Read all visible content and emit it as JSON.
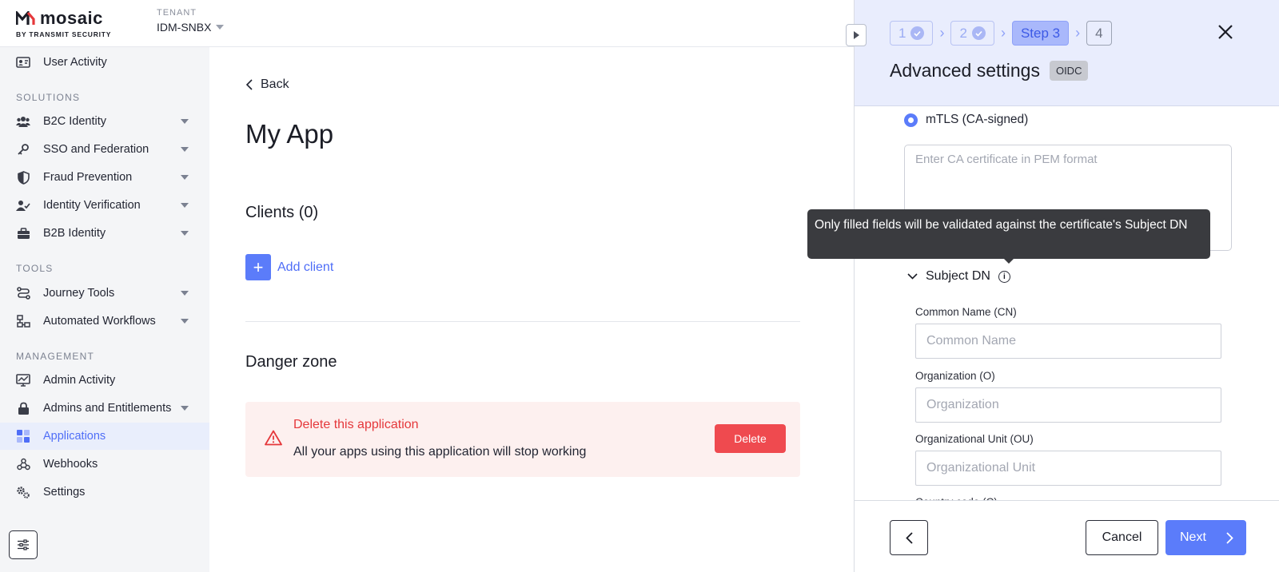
{
  "header": {
    "logo_text": "mosaic",
    "logo_sub": "BY TRANSMIT SECURITY",
    "tenant_label": "TENANT",
    "tenant_value": "IDM-SNBX"
  },
  "sidebar": {
    "top_item": "User Activity",
    "sections": {
      "solutions": "SOLUTIONS",
      "tools": "TOOLS",
      "management": "MANAGEMENT"
    },
    "items": [
      {
        "label": "B2C Identity",
        "icon": "users-icon"
      },
      {
        "label": "SSO and Federation",
        "icon": "key-icon"
      },
      {
        "label": "Fraud Prevention",
        "icon": "shield-icon"
      },
      {
        "label": "Identity Verification",
        "icon": "user-check-icon"
      },
      {
        "label": "B2B Identity",
        "icon": "briefcase-icon"
      },
      {
        "label": "Journey Tools",
        "icon": "route-icon"
      },
      {
        "label": "Automated Workflows",
        "icon": "workflow-icon"
      },
      {
        "label": "Admin Activity",
        "icon": "monitor-icon"
      },
      {
        "label": "Admins and Entitlements",
        "icon": "lock-icon"
      },
      {
        "label": "Applications",
        "icon": "grid-icon"
      },
      {
        "label": "Webhooks",
        "icon": "webhook-icon"
      },
      {
        "label": "Settings",
        "icon": "gears-icon"
      }
    ]
  },
  "main": {
    "back_label": "Back",
    "title": "My App",
    "clients_title": "Clients (0)",
    "add_client_label": "Add client",
    "danger_title": "Danger zone",
    "danger_heading": "Delete this application",
    "danger_description": "All your apps using this application will stop working",
    "delete_label": "Delete"
  },
  "panel": {
    "steps": [
      {
        "label": "1",
        "state": "done"
      },
      {
        "label": "2",
        "state": "done"
      },
      {
        "label": "Step 3",
        "state": "current"
      },
      {
        "label": "4",
        "state": "future"
      }
    ],
    "title": "Advanced settings",
    "badge": "OIDC",
    "radio_label": "mTLS (CA-signed)",
    "pem_placeholder": "Enter CA certificate in PEM format",
    "subject_dn_label": "Subject DN",
    "tooltip": "Only filled fields will be validated against the certificate's Subject DN",
    "fields": [
      {
        "label": "Common Name (CN)",
        "placeholder": "Common Name"
      },
      {
        "label": "Organization (O)",
        "placeholder": "Organization"
      },
      {
        "label": "Organizational Unit (OU)",
        "placeholder": "Organizational Unit"
      }
    ],
    "cut_field_label": "Country code (C)",
    "cancel_label": "Cancel",
    "next_label": "Next"
  },
  "colors": {
    "accent": "#5b7cfa",
    "danger": "#ef4a4f",
    "panel_header_bg": "#e9edfd",
    "sidebar_bg": "#f4f5f7"
  }
}
